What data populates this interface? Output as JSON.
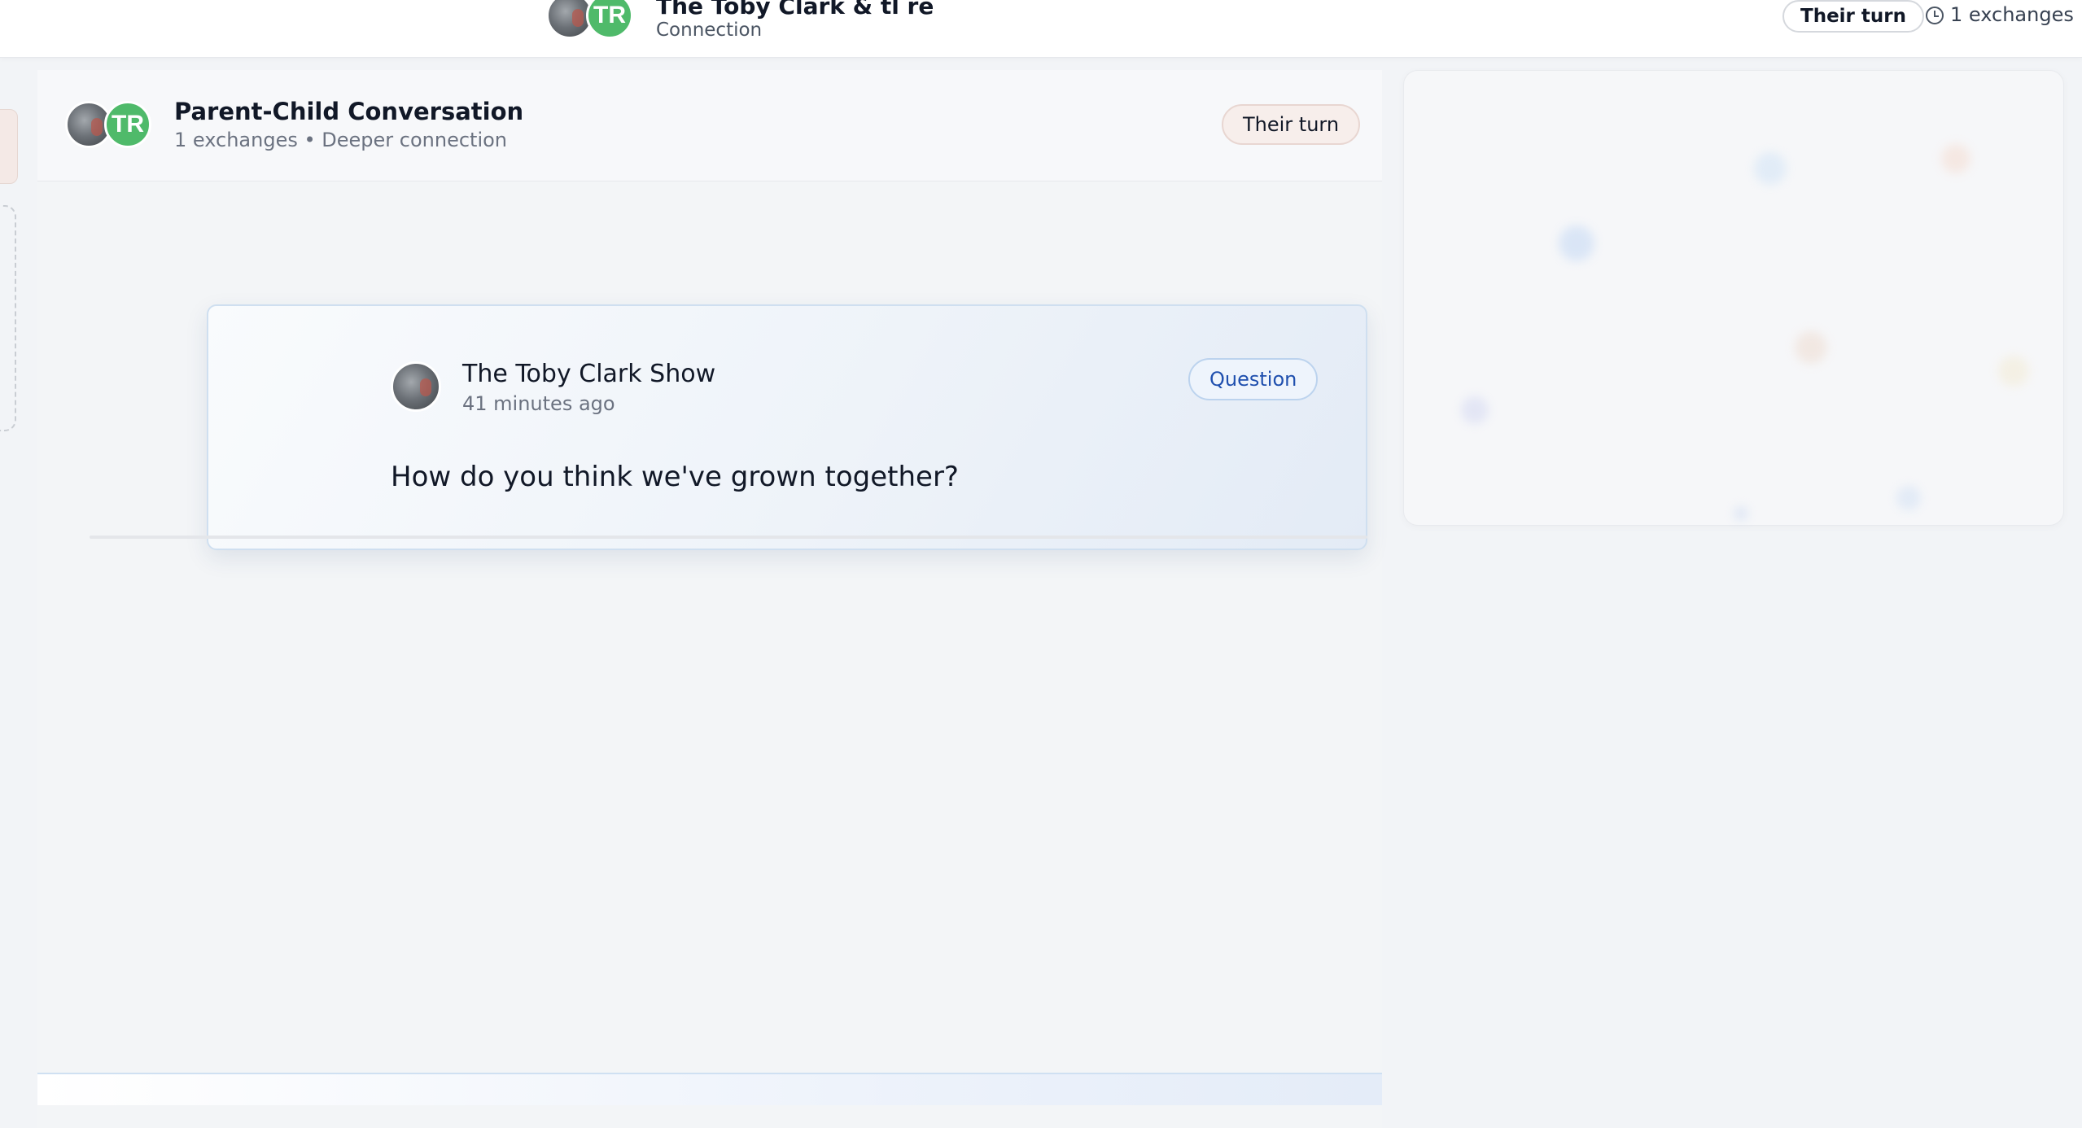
{
  "header": {
    "title": "The Toby Clark & tl re",
    "subtitle": "Connection",
    "avatar_initials": "TR",
    "turn_label": "Their turn",
    "exchanges_label": "1 exchanges"
  },
  "conversation": {
    "title": "Parent-Child Conversation",
    "meta": "1 exchanges • Deeper connection",
    "avatar_initials": "TR",
    "turn_label": "Their turn"
  },
  "question": {
    "author": "The Toby Clark Show",
    "time": "41 minutes ago",
    "badge": "Question",
    "text": "How do you think we've grown together?"
  },
  "colors": {
    "accent_green": "#4fba6a",
    "question_badge": "#1f4fae",
    "background": "#f2f4f7"
  },
  "icons": {
    "clock": "clock-icon"
  }
}
